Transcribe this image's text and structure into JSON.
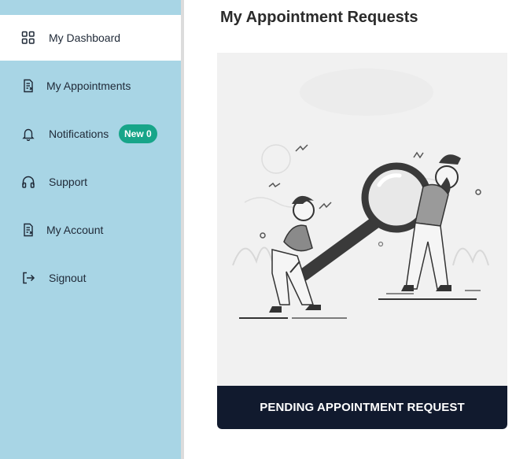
{
  "sidebar": {
    "items": [
      {
        "label": "My Dashboard",
        "icon": "dashboard-grid-icon",
        "active": true
      },
      {
        "label": "My Appointments",
        "icon": "document-list-icon"
      },
      {
        "label": "Notifications",
        "icon": "bell-icon",
        "badge": "New 0"
      },
      {
        "label": "Support",
        "icon": "headphones-icon"
      },
      {
        "label": "My Account",
        "icon": "document-list-icon"
      },
      {
        "label": "Signout",
        "icon": "signout-icon"
      }
    ],
    "background": "#a8d5e5",
    "badge_color": "#17a589"
  },
  "main": {
    "title": "My Appointment Requests",
    "card": {
      "illustration": "people-with-magnifying-glass-illustration",
      "footer_label": "PENDING APPOINTMENT REQUEST",
      "footer_color": "#111a2e"
    }
  }
}
